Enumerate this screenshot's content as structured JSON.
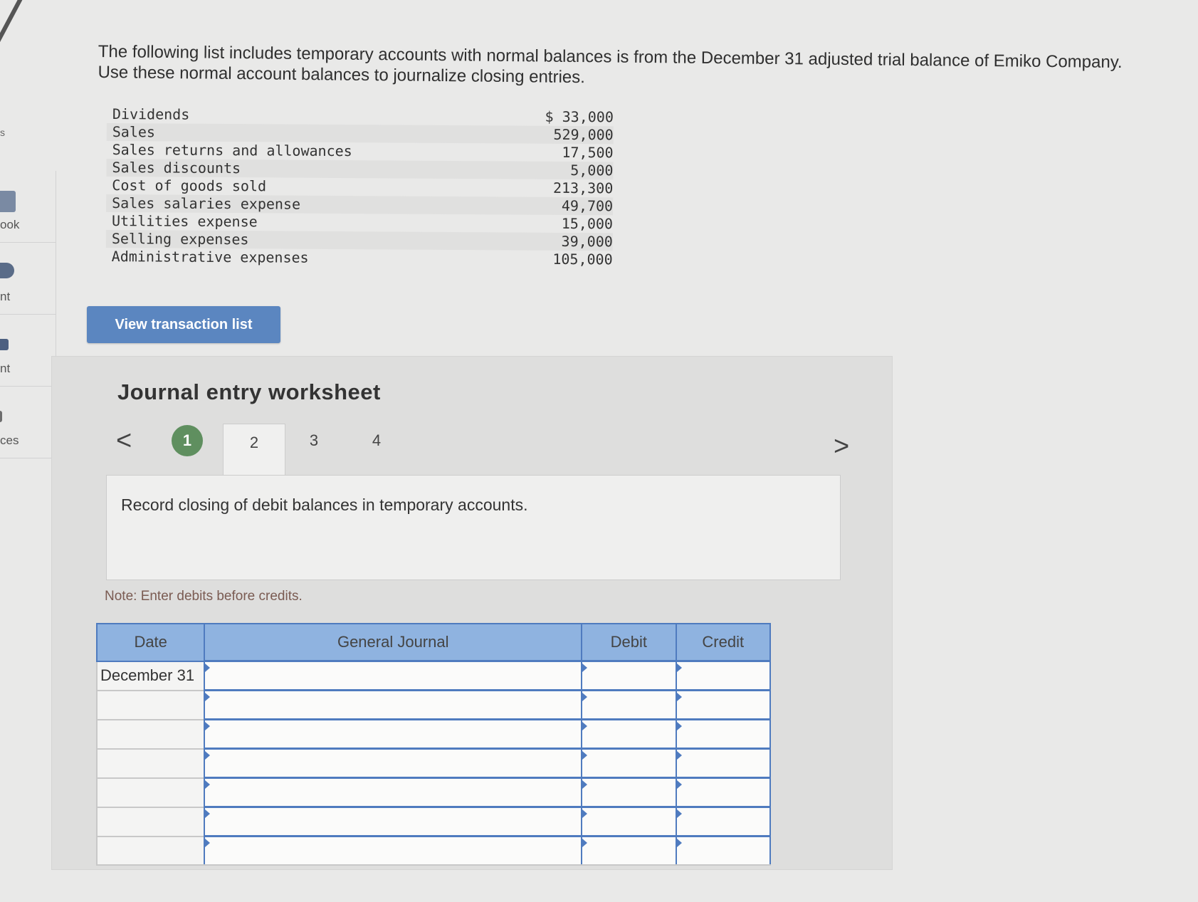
{
  "sidebar": {
    "dollar_mark": "s",
    "items": [
      {
        "label": "ook",
        "icon": "book-icon"
      },
      {
        "label": "nt",
        "icon": "print-icon"
      },
      {
        "label": "nt",
        "icon": "flag-icon"
      },
      {
        "label": "ces",
        "icon": "references-icon"
      }
    ]
  },
  "problem": {
    "intro": "The following list includes temporary accounts with normal balances is from the December 31 adjusted trial balance of Emiko Company. Use these normal account balances to journalize closing entries.",
    "accounts": [
      {
        "name": "Dividends",
        "amount": "$ 33,000"
      },
      {
        "name": "Sales",
        "amount": "529,000"
      },
      {
        "name": "Sales returns and allowances",
        "amount": "17,500"
      },
      {
        "name": "Sales discounts",
        "amount": "5,000"
      },
      {
        "name": "Cost of goods sold",
        "amount": "213,300"
      },
      {
        "name": "Sales salaries expense",
        "amount": "49,700"
      },
      {
        "name": "Utilities expense",
        "amount": "15,000"
      },
      {
        "name": "Selling expenses",
        "amount": "39,000"
      },
      {
        "name": "Administrative expenses",
        "amount": "105,000"
      }
    ]
  },
  "buttons": {
    "view_transactions": "View transaction list"
  },
  "worksheet": {
    "title": "Journal entry worksheet",
    "prev": "<",
    "next": ">",
    "tabs": [
      "1",
      "2",
      "3",
      "4"
    ],
    "active_tab": "2",
    "completed_tab": "1",
    "instruction": "Record closing of debit balances in temporary accounts.",
    "note": "Note: Enter debits before credits.",
    "table": {
      "headers": {
        "date": "Date",
        "journal": "General Journal",
        "debit": "Debit",
        "credit": "Credit"
      },
      "rows": [
        {
          "date": "December 31",
          "account": "",
          "debit": "",
          "credit": ""
        },
        {
          "date": "",
          "account": "",
          "debit": "",
          "credit": ""
        },
        {
          "date": "",
          "account": "",
          "debit": "",
          "credit": ""
        },
        {
          "date": "",
          "account": "",
          "debit": "",
          "credit": ""
        },
        {
          "date": "",
          "account": "",
          "debit": "",
          "credit": ""
        },
        {
          "date": "",
          "account": "",
          "debit": "",
          "credit": ""
        },
        {
          "date": "",
          "account": "",
          "debit": "",
          "credit": ""
        }
      ]
    }
  },
  "colors": {
    "button_blue": "#5b86c0",
    "header_blue": "#8fb3e0",
    "border_blue": "#4f7bbf",
    "completed_green": "#5f8f5f",
    "note_color": "#7a5b52"
  }
}
